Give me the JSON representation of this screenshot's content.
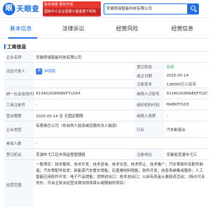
{
  "header": {
    "logo_mark": "眼",
    "logo_text": "天眼查",
    "promo_line1": "新年特惠 限时开通",
    "promo_line2": "国家中小企业发展子基金旗下机构",
    "search_value": "安徽奇瑞智能科技有限公司"
  },
  "tabs": [
    {
      "label": "基本信息"
    },
    {
      "label": "法律诉讼"
    },
    {
      "label": "经营风险"
    },
    {
      "label": "经营信息"
    }
  ],
  "section": {
    "title": "工商信息"
  },
  "info": {
    "company_name_label": "企业名称",
    "company_name": "安徽奇瑞智能科技有限公司",
    "legal_rep_label": "法定代表人",
    "legal_rep_avatar": "尹",
    "legal_rep": "尹同跃",
    "status_label": "登记状态",
    "status": "存续",
    "est_date_label": "成立日期",
    "est_date": "2025-05-14",
    "capital_label": "注册资本",
    "capital": "128000万人民币",
    "credit_code_label": "统一社会信用代码",
    "credit_code": "91340200MAEKFYLD54",
    "taxpayer_id_label": "纳税人识别号",
    "taxpayer_id": "91340200MAEKFYLD54",
    "reg_no_label": "工商注册号",
    "reg_no": "-",
    "org_code_label": "组织机构代码",
    "org_code": "MAEKFYLD5",
    "period_label": "营业期限",
    "period": "2025-05-14 至 无固定期限",
    "taxpayer_qual_label": "纳税人资质",
    "taxpayer_qual": "-",
    "company_type_label": "企业类型",
    "company_type": "有限责任公司（非自然人投资或控股的法人独资）",
    "industry_label": "行业",
    "industry": "汽车制造业",
    "staff_label": "参保人数",
    "staff": "-",
    "authority_label": "登记机关",
    "authority": "芜湖市弋江区市场监督管理局",
    "region_label": "注册地址",
    "region": "安徽省芜湖市弋江",
    "scope_label": "经营范围",
    "scope": "一般项目：技术服务、技术开发、技术咨询、技术交流、技术转让、技术推广；汽车零部件及配件制造；汽车零配件批发；新能源汽车整车销售；石墨烯材料销售；软件开发；信息系统集成服务；人工智能应用软件开发；电子产品销售；货物进出口；技术进出口；以自有资金从事投资活动；（除许可业务外，可自主依法经营法律法规非禁止或限制的项目）"
  }
}
